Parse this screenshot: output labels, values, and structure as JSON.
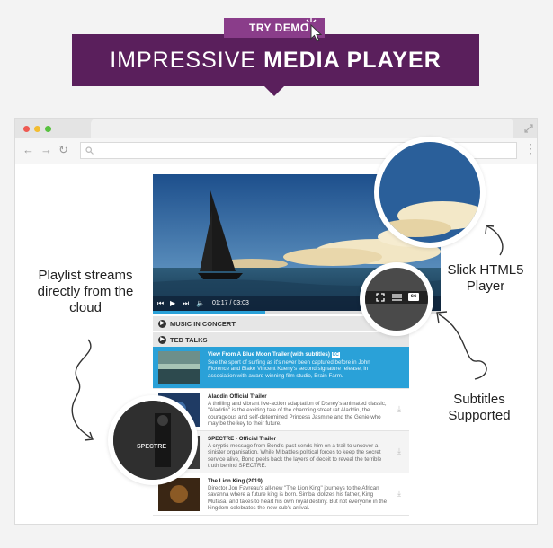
{
  "banner": {
    "demo_label": "TRY DEMO",
    "title_light": "IMPRESSIVE",
    "title_bold": "MEDIA PLAYER"
  },
  "player": {
    "time": "01:17 / 03:03",
    "progress_fraction": 0.39
  },
  "playlist": {
    "categories": [
      "MUSIC IN CONCERT",
      "TED TALKS"
    ],
    "items": [
      {
        "title": "View From A Blue Moon Trailer (with subtitles)",
        "badge": "CC",
        "description": "See the sport of surfing as it's never been captured before in John Florence and Blake Vincent Kueny's second signature release, in association with award-winning film studio, Brain Farm.",
        "active": true
      },
      {
        "title": "Aladdin Official Trailer",
        "description": "A thrilling and vibrant live-action adaptation of Disney's animated classic, \"Aladdin\" is the exciting tale of the charming street rat Aladdin, the courageous and self-determined Princess Jasmine and the Genie who may be the key to their future.",
        "active": false
      },
      {
        "title": "SPECTRE - Official Trailer",
        "description": "A cryptic message from Bond's past sends him on a trail to uncover a sinister organisation. While M battles political forces to keep the secret service alive, Bond peels back the layers of deceit to reveal the terrible truth behind SPECTRE.",
        "active": false
      },
      {
        "title": "The Lion King (2019)",
        "description": "Director Jon Favreau's all-new \"The Lion King\" journeys to the African savanna where a future king is born. Simba idolizes his father, King Mufasa, and takes to heart his own royal destiny. But not everyone in the kingdom celebrates the new cub's arrival.",
        "active": false
      }
    ]
  },
  "callouts": {
    "playlist": "Playlist streams directly from the cloud",
    "player": "Slick HTML5 Player",
    "subtitles": "Subtitles Supported"
  },
  "magnified_thumb_text": "SPECTRE",
  "colors": {
    "banner": "#5a1f5c",
    "demo_tag": "#8a3d8a",
    "accent": "#2aa1d8"
  }
}
